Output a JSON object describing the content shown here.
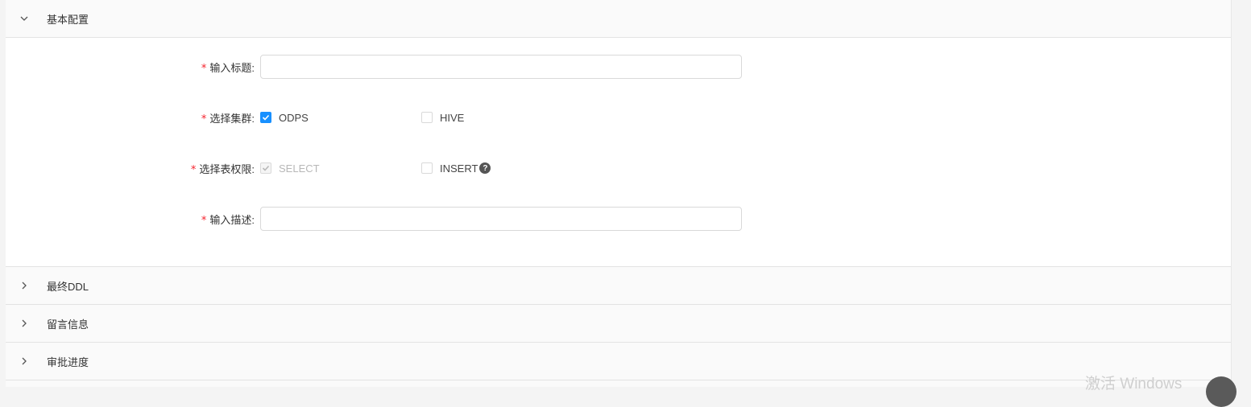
{
  "panels": [
    {
      "title": "基本配置",
      "expanded": true
    },
    {
      "title": "最终DDL",
      "expanded": false
    },
    {
      "title": "留言信息",
      "expanded": false
    },
    {
      "title": "审批进度",
      "expanded": false
    }
  ],
  "form": {
    "required_mark": "*",
    "title_label": "输入标题:",
    "title_value": "",
    "cluster_label": "选择集群:",
    "cluster_options": [
      {
        "label": "ODPS",
        "checked": true
      },
      {
        "label": "HIVE",
        "checked": false
      }
    ],
    "permission_label": "选择表权限:",
    "permission_options": [
      {
        "label": "SELECT",
        "checked": true,
        "disabled": true
      },
      {
        "label": "INSERT",
        "checked": false,
        "disabled": false
      }
    ],
    "help_glyph": "?",
    "desc_label": "输入描述:",
    "desc_value": ""
  },
  "watermark": "激活 Windows",
  "colors": {
    "accent": "#1890ff",
    "required": "#f5222d"
  }
}
